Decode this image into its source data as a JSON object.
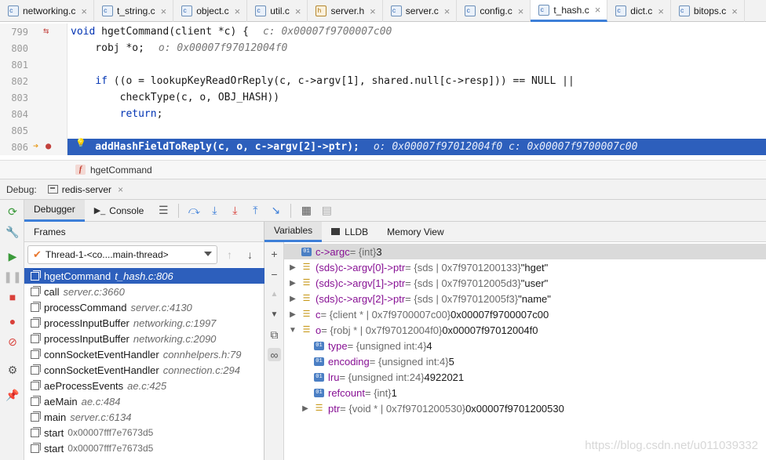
{
  "tabs": [
    {
      "label": "networking.c",
      "type": "c"
    },
    {
      "label": "t_string.c",
      "type": "c"
    },
    {
      "label": "object.c",
      "type": "c"
    },
    {
      "label": "util.c",
      "type": "c"
    },
    {
      "label": "server.h",
      "type": "h"
    },
    {
      "label": "server.c",
      "type": "c"
    },
    {
      "label": "config.c",
      "type": "c"
    },
    {
      "label": "t_hash.c",
      "type": "c",
      "active": true
    },
    {
      "label": "dict.c",
      "type": "c"
    },
    {
      "label": "bitops.c",
      "type": "c"
    }
  ],
  "editor": {
    "lines": [
      {
        "num": "799",
        "pre": "",
        "kw": "void",
        "post": " hgetCommand(client *c) {",
        "inline": "c: 0x00007f9700007c00"
      },
      {
        "num": "800",
        "pre": "    robj *o;",
        "kw": "",
        "post": "",
        "inline": "o: 0x00007f97012004f0"
      },
      {
        "num": "801",
        "pre": "",
        "kw": "",
        "post": "",
        "inline": ""
      },
      {
        "num": "802",
        "pre": "    ",
        "kw": "if",
        "post": " ((o = lookupKeyReadOrReply(c, c->argv[1], shared.null[c->resp])) == NULL ||",
        "inline": ""
      },
      {
        "num": "803",
        "pre": "        checkType(c, o, OBJ_HASH))",
        "kw": "",
        "post": "",
        "inline": ""
      },
      {
        "num": "804",
        "pre": "        ",
        "kw": "return",
        "post": ";",
        "inline": ""
      },
      {
        "num": "805",
        "pre": "",
        "kw": "",
        "post": "",
        "inline": ""
      },
      {
        "num": "806",
        "pre": "    addHashFieldToReply(c, o, c->argv[2]->ptr);",
        "kw": "",
        "post": "",
        "inline": "o: 0x00007f97012004f0    c: 0x00007f9700007c00"
      }
    ],
    "breadcrumb": "hgetCommand"
  },
  "debug": {
    "label": "Debug:",
    "session": "redis-server",
    "tabs": {
      "debugger": "Debugger",
      "console": "Console"
    },
    "frames_title": "Frames",
    "thread": "Thread-1-<co....main-thread>",
    "frames": [
      {
        "name": "hgetCommand",
        "loc": "t_hash.c:806",
        "addr": ""
      },
      {
        "name": "call",
        "loc": "server.c:3660",
        "addr": ""
      },
      {
        "name": "processCommand",
        "loc": "server.c:4130",
        "addr": ""
      },
      {
        "name": "processInputBuffer",
        "loc": "networking.c:1997",
        "addr": ""
      },
      {
        "name": "processInputBuffer",
        "loc": "networking.c:2090",
        "addr": ""
      },
      {
        "name": "connSocketEventHandler",
        "loc": "connhelpers.h:79",
        "addr": ""
      },
      {
        "name": "connSocketEventHandler",
        "loc": "connection.c:294",
        "addr": ""
      },
      {
        "name": "aeProcessEvents",
        "loc": "ae.c:425",
        "addr": ""
      },
      {
        "name": "aeMain",
        "loc": "ae.c:484",
        "addr": ""
      },
      {
        "name": "main",
        "loc": "server.c:6134",
        "addr": ""
      },
      {
        "name": "start",
        "loc": "",
        "addr": "0x00007fff7e7673d5"
      },
      {
        "name": "start",
        "loc": "",
        "addr": "0x00007fff7e7673d5"
      }
    ],
    "var_tabs": {
      "variables": "Variables",
      "lldb": "LLDB",
      "memory": "Memory View"
    },
    "variables": [
      {
        "name": "c->argc",
        "type": "= {int}",
        "value": "3",
        "expand": "",
        "icon": "01"
      },
      {
        "name": "(sds)c->argv[0]->ptr",
        "type": "= {sds | 0x7f9701200133}",
        "value": "\"hget\"",
        "expand": "▶",
        "icon": "bars"
      },
      {
        "name": "(sds)c->argv[1]->ptr",
        "type": "= {sds | 0x7f97012005d3}",
        "value": "\"user\"",
        "expand": "▶",
        "icon": "bars"
      },
      {
        "name": "(sds)c->argv[2]->ptr",
        "type": "= {sds | 0x7f97012005f3}",
        "value": "\"name\"",
        "expand": "▶",
        "icon": "bars"
      },
      {
        "name": "c",
        "type": "= {client * | 0x7f9700007c00}",
        "value": "0x00007f9700007c00",
        "expand": "▶",
        "icon": "bars"
      },
      {
        "name": "o",
        "type": "= {robj * | 0x7f97012004f0}",
        "value": "0x00007f97012004f0",
        "expand": "▼",
        "icon": "bars"
      },
      {
        "name": "type",
        "type": "= {unsigned int:4}",
        "value": "4",
        "expand": "",
        "icon": "01"
      },
      {
        "name": "encoding",
        "type": "= {unsigned int:4}",
        "value": "5",
        "expand": "",
        "icon": "01"
      },
      {
        "name": "lru",
        "type": "= {unsigned int:24}",
        "value": "4922021",
        "expand": "",
        "icon": "01"
      },
      {
        "name": "refcount",
        "type": "= {int}",
        "value": "1",
        "expand": "",
        "icon": "01"
      },
      {
        "name": "ptr",
        "type": "= {void * | 0x7f9701200530}",
        "value": "0x00007f9701200530",
        "expand": "▶",
        "icon": "bars"
      }
    ]
  },
  "watermark": "https://blog.csdn.net/u011039332",
  "colors": {
    "accent": "#3d7fd8",
    "exec_line": "#2d5fbc",
    "var_name": "#871094",
    "keyword": "#0033b3"
  }
}
